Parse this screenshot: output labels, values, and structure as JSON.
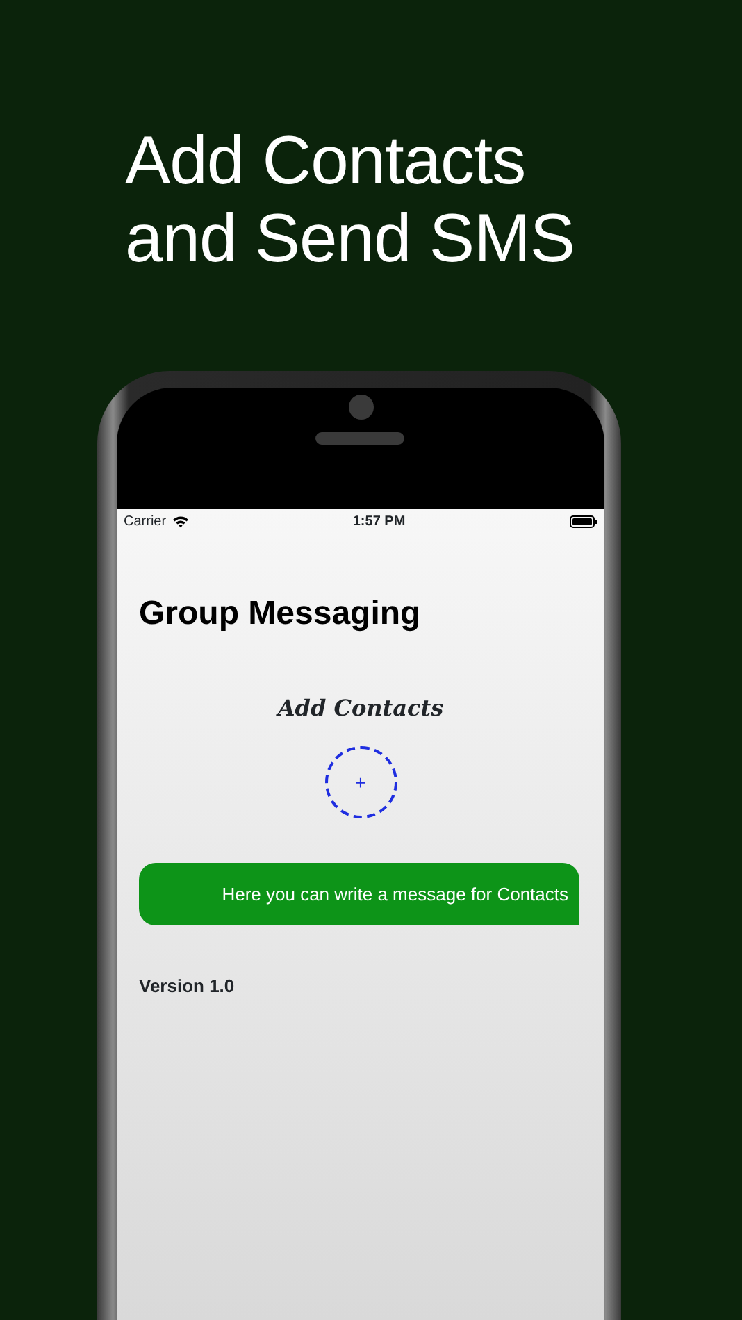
{
  "headline": [
    "Add Contacts",
    "and Send SMS"
  ],
  "status_bar": {
    "carrier": "Carrier",
    "time": "1:57 PM"
  },
  "app": {
    "title": "Group Messaging",
    "add_contacts_label": "Add Contacts",
    "add_button": "+",
    "message_field": {
      "placeholder": "Here you can write a message for Contacts"
    },
    "version": "Version 1.0"
  }
}
